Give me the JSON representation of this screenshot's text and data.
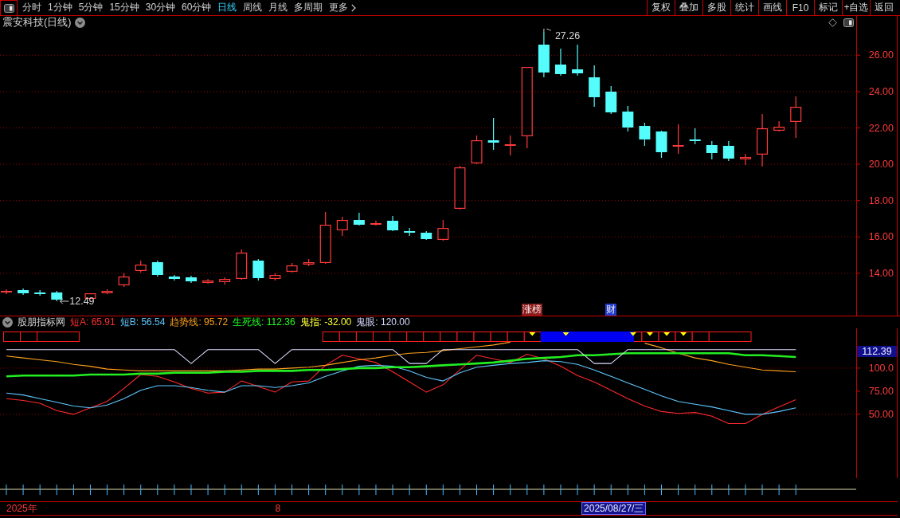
{
  "toolbar": {
    "periods": [
      {
        "label": "分时",
        "selected": false
      },
      {
        "label": "1分钟",
        "selected": false
      },
      {
        "label": "5分钟",
        "selected": false
      },
      {
        "label": "15分钟",
        "selected": false
      },
      {
        "label": "30分钟",
        "selected": false
      },
      {
        "label": "60分钟",
        "selected": false
      },
      {
        "label": "日线",
        "selected": true
      },
      {
        "label": "周线",
        "selected": false
      },
      {
        "label": "月线",
        "selected": false
      },
      {
        "label": "多周期",
        "selected": false
      }
    ],
    "more": "更多",
    "actions": [
      "复权",
      "叠加",
      "多股",
      "统计",
      "画线",
      "F10",
      "标记",
      "+自选",
      "返回"
    ]
  },
  "price_chart": {
    "title": "震安科技(日线)",
    "high_label": "27.26",
    "low_label": "12.49",
    "axis_labels": [
      "26.00",
      "24.00",
      "22.00",
      "20.00",
      "18.00",
      "16.00",
      "14.00"
    ],
    "events": [
      {
        "label": "涨榜",
        "color": "#8b1c1c"
      },
      {
        "label": "财",
        "color": "#1f3fd0"
      }
    ]
  },
  "indicator": {
    "name": "股朋指标网",
    "legend": [
      {
        "text": "短A: 65.91",
        "color": "#ff3030"
      },
      {
        "text": "短B: 56.54",
        "color": "#5fc8ff"
      },
      {
        "text": "趋势线: 95.72",
        "color": "#ffa21e"
      },
      {
        "text": "生死线: 112.36",
        "color": "#22ff22"
      },
      {
        "text": "鬼指: -32.00",
        "color": "#ffff33"
      },
      {
        "text": "鬼眼: 120.00",
        "color": "#d8d8ff"
      }
    ],
    "current_value": "112.39",
    "signal_groups": [
      {
        "cells": [
          {
            "filled": false,
            "marker": false
          },
          {
            "filled": false,
            "marker": false
          },
          {
            "filled": false,
            "marker": false
          }
        ]
      },
      {
        "cells": [
          {
            "filled": false,
            "marker": false
          },
          {
            "filled": false,
            "marker": false
          },
          {
            "filled": false,
            "marker": false
          },
          {
            "filled": false,
            "marker": false
          },
          {
            "filled": false,
            "marker": false
          },
          {
            "filled": false,
            "marker": false
          },
          {
            "filled": false,
            "marker": false
          },
          {
            "filled": false,
            "marker": false
          },
          {
            "filled": false,
            "marker": false
          },
          {
            "filled": false,
            "marker": false
          },
          {
            "filled": false,
            "marker": false
          },
          {
            "filled": false,
            "marker": false
          },
          {
            "filled": false,
            "marker": true
          },
          {
            "filled": true,
            "marker": false
          },
          {
            "filled": true,
            "marker": true
          },
          {
            "filled": true,
            "marker": false
          },
          {
            "filled": true,
            "marker": false
          },
          {
            "filled": true,
            "marker": false
          },
          {
            "filled": false,
            "marker": true
          },
          {
            "filled": false,
            "marker": true
          },
          {
            "filled": false,
            "marker": true
          },
          {
            "filled": false,
            "marker": true
          },
          {
            "filled": false,
            "marker": false
          },
          {
            "filled": false,
            "marker": false
          }
        ]
      }
    ],
    "chart_data": {
      "type": "line",
      "ylim": [
        -19,
        143
      ],
      "yticks": [
        {
          "value": 100,
          "label": "100.0"
        },
        {
          "value": 75,
          "label": "75.00"
        },
        {
          "value": 50,
          "label": "50.00"
        }
      ],
      "series": [
        {
          "color": "#ff2a2a",
          "values": [
            67,
            65,
            62,
            54,
            50,
            57,
            64,
            78,
            93,
            91,
            85,
            78,
            73,
            74,
            86,
            80,
            74,
            85,
            86,
            103,
            114,
            110,
            106,
            96,
            85,
            74,
            82,
            98,
            114,
            110,
            106,
            115,
            110,
            102,
            92,
            85,
            76,
            67,
            59,
            53,
            51,
            52,
            48,
            40,
            40,
            50,
            58,
            66
          ]
        },
        {
          "color": "#5fc8ff",
          "values": [
            73,
            71,
            67,
            63,
            59,
            57,
            60,
            67,
            76,
            81,
            81,
            79,
            76,
            74,
            81,
            81,
            79,
            81,
            84,
            91,
            97,
            102,
            103,
            102,
            97,
            90,
            86,
            95,
            101,
            103,
            105,
            106,
            108,
            107,
            104,
            98,
            91,
            84,
            77,
            70,
            64,
            61,
            58,
            54,
            50,
            50,
            53,
            57
          ]
        },
        {
          "color": "#ffa21e",
          "values": [
            113,
            111,
            109,
            107,
            104,
            102,
            99,
            98,
            97,
            97,
            97,
            97,
            97,
            97,
            98,
            99,
            99,
            100,
            101,
            103,
            106,
            109,
            111,
            114,
            116,
            117,
            119,
            121,
            123,
            125,
            128,
            null,
            null,
            null,
            null,
            null,
            null,
            null,
            127,
            122,
            116,
            111,
            108,
            104,
            101,
            98,
            97,
            96
          ]
        },
        {
          "color": "#22ee22",
          "values": [
            91,
            92,
            92,
            92,
            92,
            93,
            93,
            93,
            94,
            94,
            95,
            95,
            95,
            96,
            96,
            97,
            97,
            97,
            98,
            98,
            99,
            100,
            100,
            101,
            101,
            102,
            103,
            104,
            105,
            106,
            108,
            110,
            111,
            112,
            114,
            114,
            115,
            116,
            116,
            116,
            116,
            116,
            116,
            116,
            114,
            114,
            113,
            112
          ]
        },
        {
          "color": "#dcdcff",
          "values": [
            120,
            120,
            120,
            120,
            120,
            120,
            120,
            120,
            120,
            120,
            120,
            105,
            120,
            120,
            120,
            120,
            105,
            120,
            120,
            120,
            120,
            120,
            120,
            120,
            105,
            105,
            120,
            120,
            120,
            120,
            120,
            120,
            120,
            120,
            120,
            105,
            105,
            120,
            120,
            120,
            120,
            120,
            120,
            120,
            120,
            120,
            120,
            120
          ]
        }
      ]
    }
  },
  "time_axis": {
    "labels": [
      "2025年",
      "8"
    ],
    "cursor_date": "2025/08/27/三"
  }
}
